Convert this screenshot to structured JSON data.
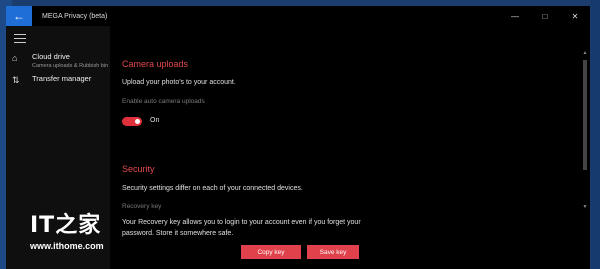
{
  "window": {
    "title": "MEGA Privacy (beta)",
    "back_icon": "←",
    "controls": {
      "minimize": "—",
      "maximize": "□",
      "close": "✕"
    }
  },
  "sidebar": {
    "menu_icon": "hamburger-icon",
    "items": [
      {
        "label": "Cloud drive",
        "sublabel": "Camera uploads & Rubbish bin",
        "icon": "⌂"
      },
      {
        "label": "Transfer manager",
        "sublabel": "",
        "icon": "⇅"
      }
    ]
  },
  "camera": {
    "title": "Camera uploads",
    "description": "Upload your photo's to your account.",
    "toggle_label": "Enable auto camera uploads",
    "toggle_state": "On"
  },
  "security": {
    "title": "Security",
    "description": "Security settings differ on each of your connected devices.",
    "recovery_title": "Recovery key",
    "recovery_line1": "Your Recovery key allows you to login to your account even if you forget your",
    "recovery_line2": "password. Store it somewhere safe.",
    "copy_label": "Copy key",
    "save_label": "Save key"
  },
  "watermark": {
    "logo": "IT之家",
    "url": "www.ithome.com"
  },
  "colors": {
    "accent": "#e0414a",
    "title_bar_button": "#1f6dd6"
  }
}
